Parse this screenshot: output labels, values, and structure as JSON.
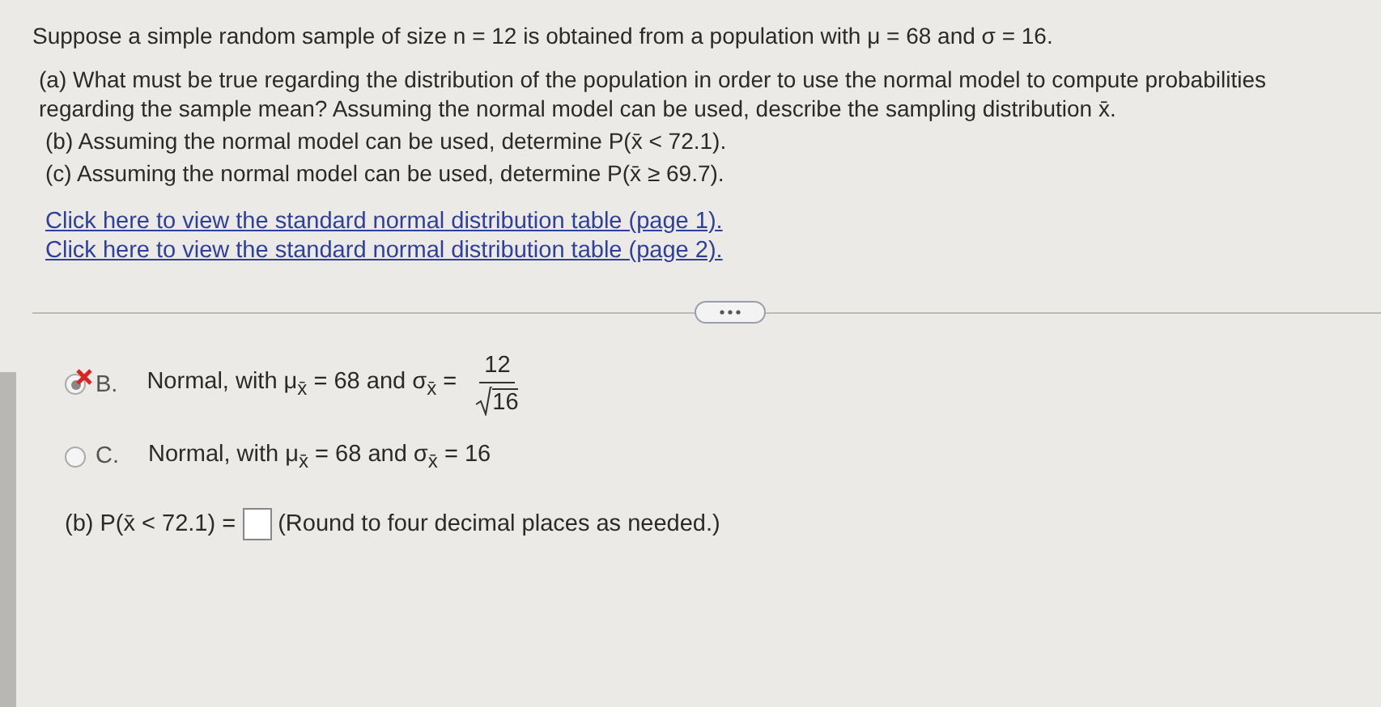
{
  "intro": "Suppose a simple random sample of size n = 12 is obtained from a population with μ = 68 and σ = 16.",
  "questions": [
    "(a) What must be true regarding the distribution of the population in order to use the normal model to compute probabilities regarding the sample mean? Assuming the normal model can be used, describe the sampling distribution x̄.",
    "(b) Assuming the normal model can be used, determine P(x̄ < 72.1).",
    "(c) Assuming the normal model can be used, determine P(x̄ ≥ 69.7)."
  ],
  "links": [
    "Click here to view the standard normal distribution table (page 1).",
    "Click here to view the standard normal distribution table (page 2)."
  ],
  "options": [
    {
      "letter": "B.",
      "selected": true,
      "marked_wrong": true,
      "kind": "fraction",
      "text": "Normal, with μ$_{x̄}$ = 68 and σ$_{x̄}$ =",
      "numerator": "12",
      "denominator": "16"
    },
    {
      "letter": "C.",
      "selected": false,
      "marked_wrong": false,
      "kind": "plain",
      "text": "Normal, with μ$_{x̄}$ = 68 and σ$_{x̄}$ = 16"
    }
  ],
  "answer": {
    "label": "(b) P(x̄ < 72.1) =",
    "note": "(Round to four decimal places as needed.)"
  }
}
